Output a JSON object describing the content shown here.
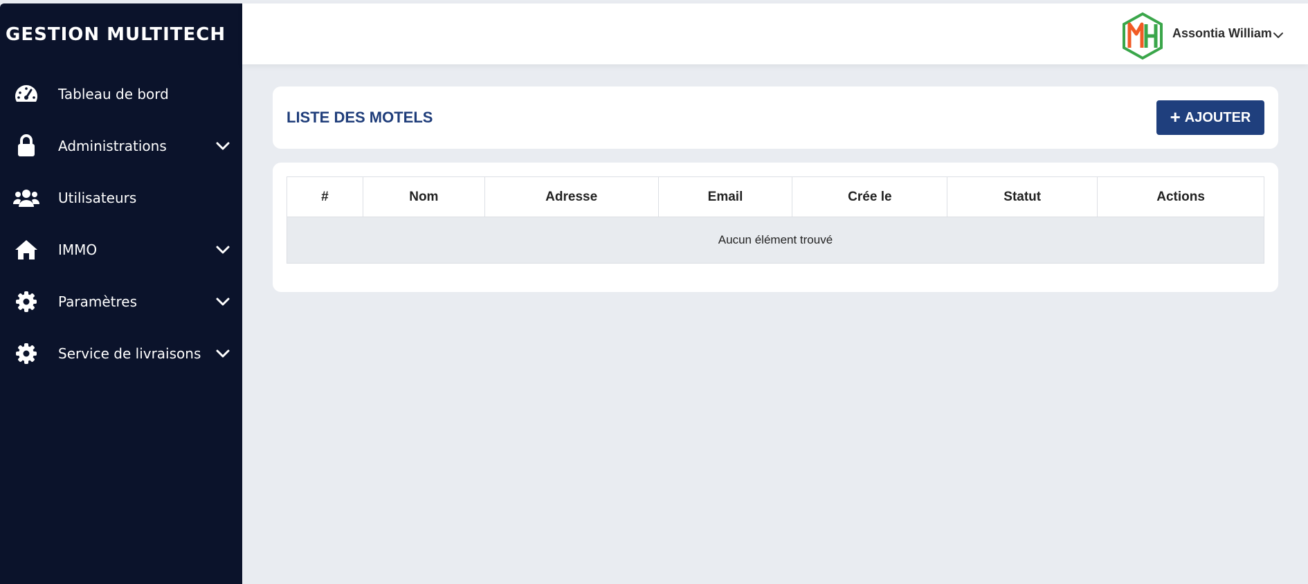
{
  "app": {
    "brand": "GESTION MULTITECH"
  },
  "sidebar": {
    "items": [
      {
        "label": "Tableau de bord",
        "icon": "dashboard-gauge-icon",
        "has_submenu": false
      },
      {
        "label": "Administrations",
        "icon": "lock-icon",
        "has_submenu": true
      },
      {
        "label": "Utilisateurs",
        "icon": "users-icon",
        "has_submenu": false
      },
      {
        "label": "IMMO",
        "icon": "home-icon",
        "has_submenu": true
      },
      {
        "label": "Paramètres",
        "icon": "gear-icon",
        "has_submenu": true
      },
      {
        "label": "Service de livraisons",
        "icon": "gear-icon",
        "has_submenu": true
      }
    ]
  },
  "header": {
    "user_name": "Assontia William",
    "logo_text": "MH",
    "logo_colors": {
      "border": "#3aa64a",
      "m": "#f15a24",
      "h": "#3aa64a"
    }
  },
  "main": {
    "title": "LISTE DES MOTELS",
    "add_button": {
      "icon": "+",
      "label": "AJOUTER"
    },
    "table": {
      "columns": [
        "#",
        "Nom",
        "Adresse",
        "Email",
        "Crée le",
        "Statut",
        "Actions"
      ],
      "empty_message": "Aucun élément trouvé"
    }
  },
  "colors": {
    "sidebar_bg": "#0b132b",
    "page_bg": "#e9ecf1",
    "accent": "#1f3f7d",
    "title": "#1f3d7a"
  }
}
